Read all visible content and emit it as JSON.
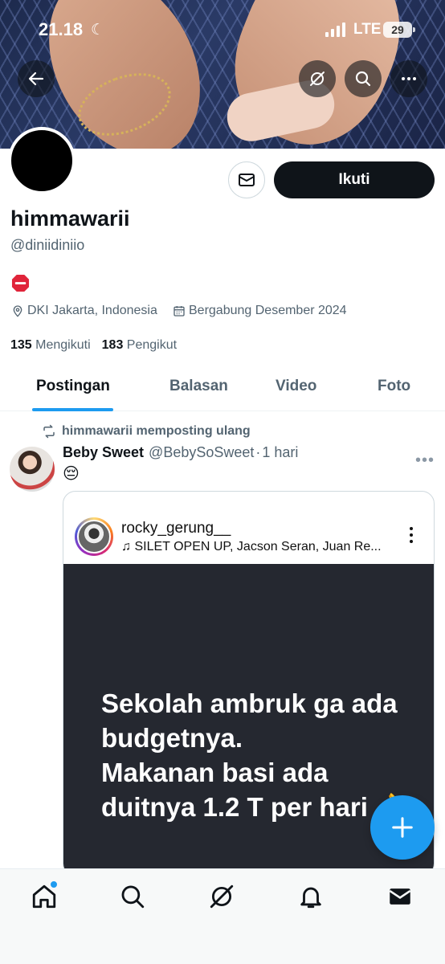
{
  "status_bar": {
    "time": "21.18",
    "network": "LTE",
    "battery": "29"
  },
  "profile": {
    "display_name": "himmawarii",
    "handle": "@diniidiniio",
    "bio_emoji": "🛑",
    "location": "DKI Jakarta, Indonesia",
    "joined": "Bergabung Desember 2024",
    "following_count": "135",
    "following_label": "Mengikuti",
    "followers_count": "183",
    "followers_label": "Pengikut",
    "follow_button": "Ikuti"
  },
  "tabs": [
    {
      "label": "Postingan",
      "active": true
    },
    {
      "label": "Balasan",
      "active": false
    },
    {
      "label": "Video",
      "active": false
    },
    {
      "label": "Foto",
      "active": false
    }
  ],
  "post": {
    "repost_text": "himmawarii memposting ulang",
    "author_name": "Beby Sweet",
    "author_handle": "@BebySoSweet",
    "separator": "·",
    "time": "1 hari",
    "text": "😔",
    "more": "•••",
    "embed": {
      "account": "rocky_gerung__",
      "music": "SILET OPEN UP, Jacson Seran, Juan Re...",
      "caption_lines": [
        "Sekolah ambruk ga ada",
        "budgetnya.",
        "Makanan basi ada",
        "duitnya 1.2 T per hari 👌"
      ]
    }
  },
  "icons": {
    "back": "back-arrow-icon",
    "grok": "grok-icon",
    "search": "search-icon",
    "more": "more-horizontal-icon",
    "message": "envelope-icon",
    "location": "location-pin-icon",
    "calendar": "calendar-icon",
    "repost": "repost-icon",
    "music": "music-note-icon",
    "compose": "plus-icon",
    "nav": [
      "home-icon",
      "search-icon",
      "grok-icon",
      "bell-icon",
      "mail-icon"
    ]
  },
  "colors": {
    "accent": "#1d9bf0",
    "text": "#0f1419",
    "secondary": "#536471"
  }
}
